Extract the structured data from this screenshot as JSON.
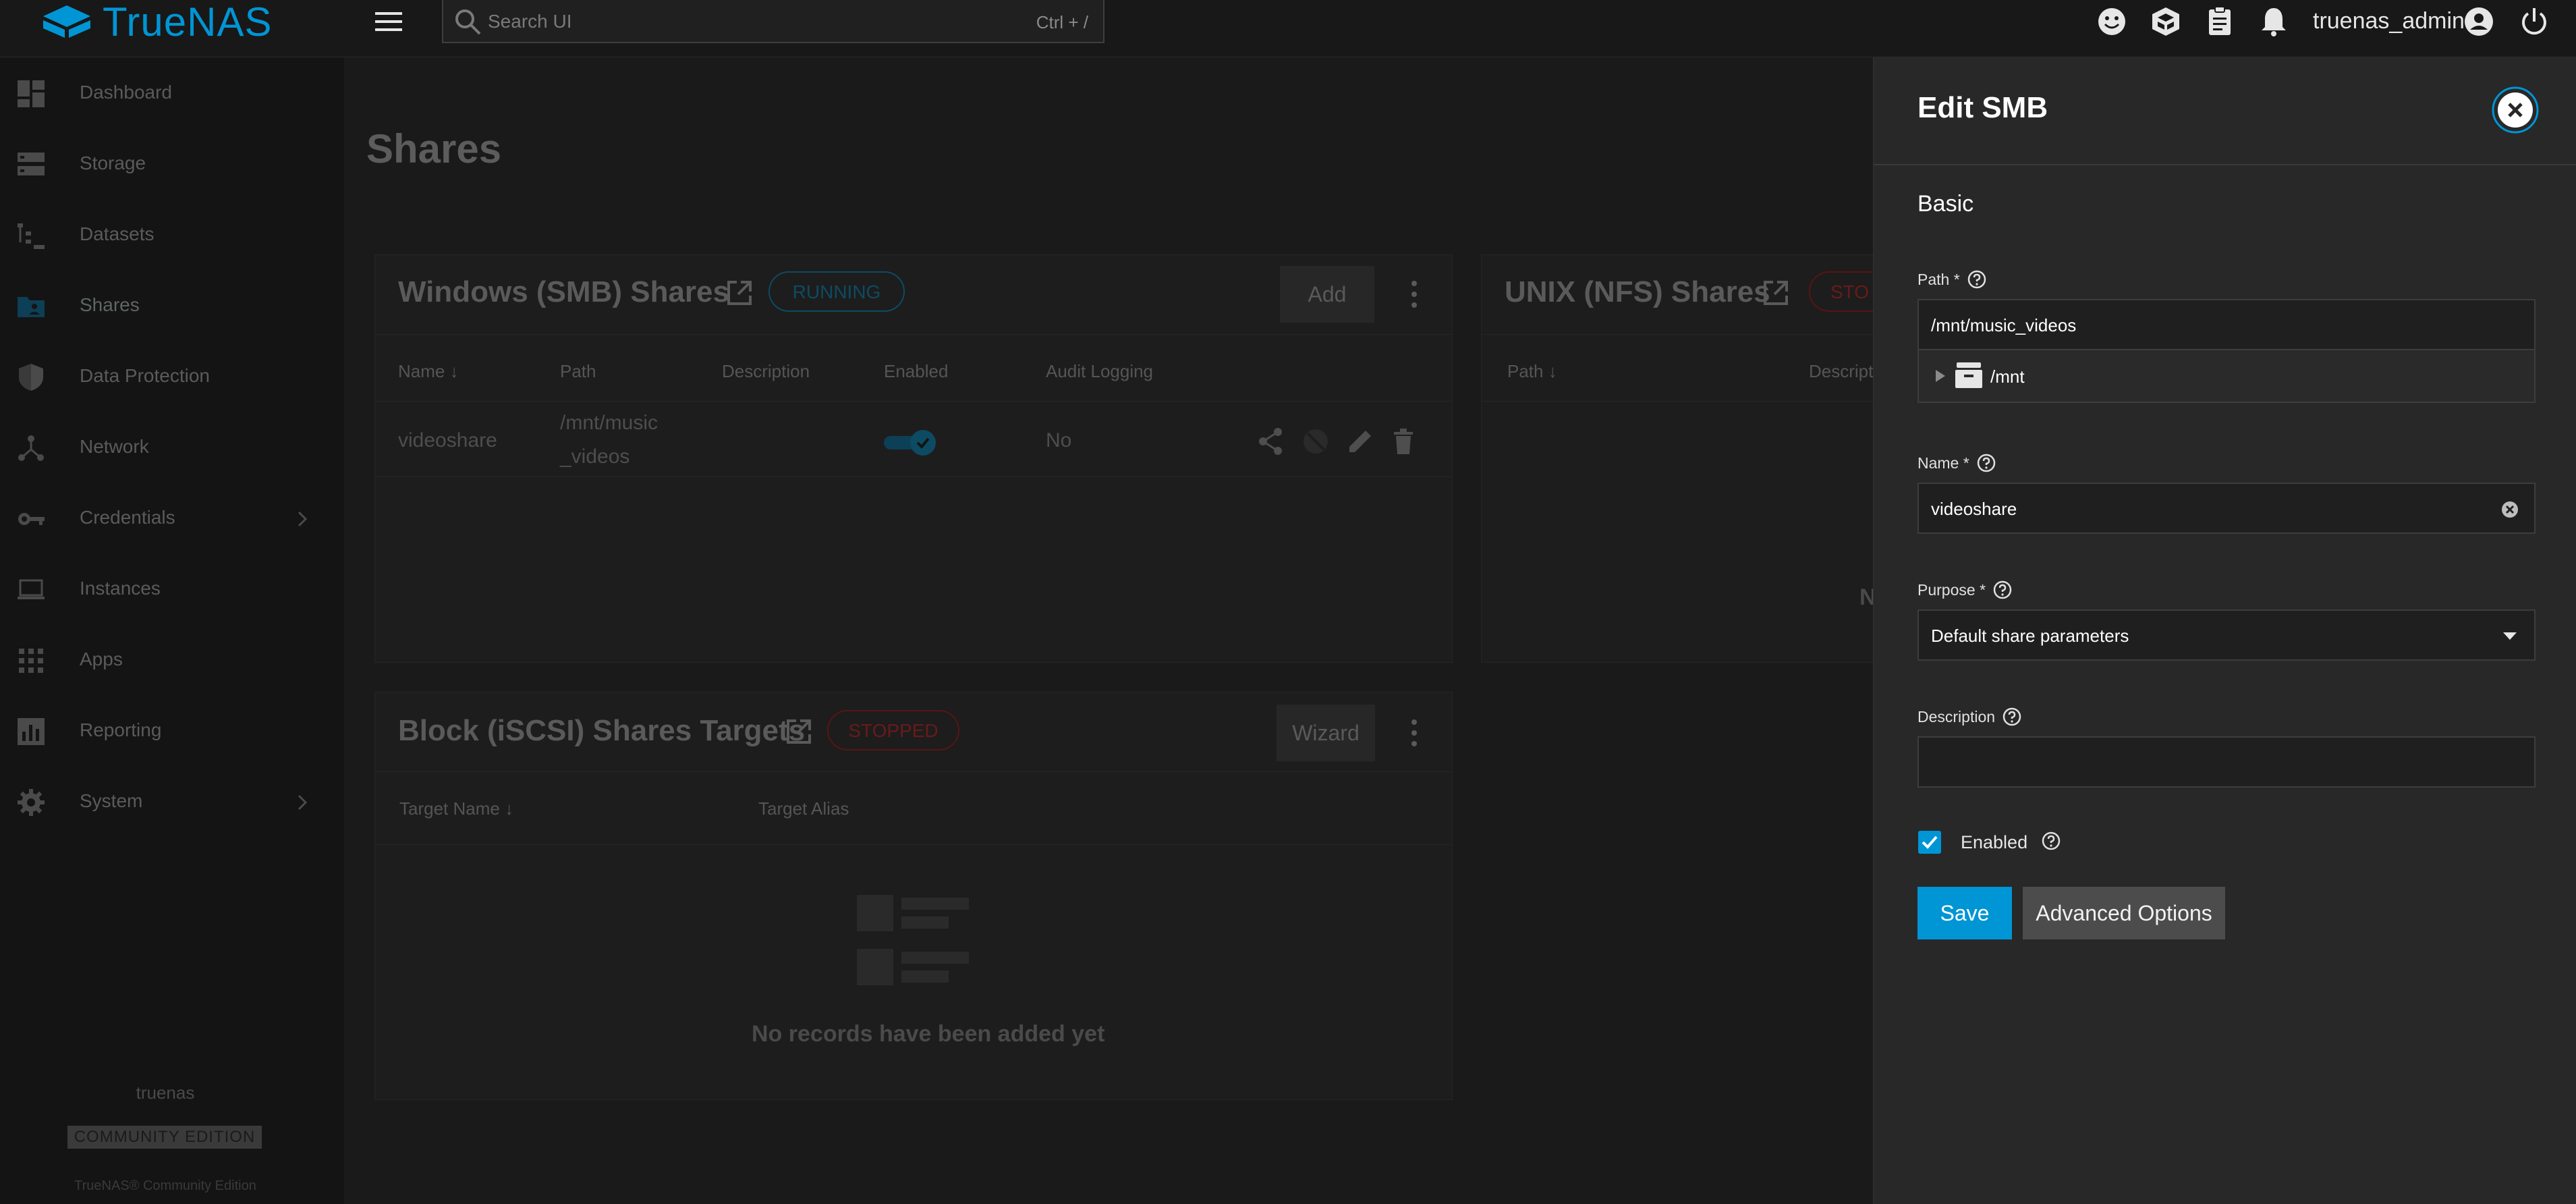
{
  "app": {
    "logo_text": "TrueNAS"
  },
  "search": {
    "placeholder": "Search UI",
    "shortcut": "Ctrl + /"
  },
  "user": {
    "name": "truenas_admin"
  },
  "sidebar": {
    "items": [
      {
        "label": "Dashboard",
        "icon": "dashboard-icon"
      },
      {
        "label": "Storage",
        "icon": "storage-icon"
      },
      {
        "label": "Datasets",
        "icon": "datasets-icon"
      },
      {
        "label": "Shares",
        "icon": "folder-shared-icon",
        "active": true
      },
      {
        "label": "Data Protection",
        "icon": "shield-icon"
      },
      {
        "label": "Network",
        "icon": "network-icon"
      },
      {
        "label": "Credentials",
        "icon": "key-icon",
        "has_children": true
      },
      {
        "label": "Instances",
        "icon": "laptop-icon"
      },
      {
        "label": "Apps",
        "icon": "apps-grid-icon"
      },
      {
        "label": "Reporting",
        "icon": "chart-icon"
      },
      {
        "label": "System",
        "icon": "gear-icon",
        "has_children": true
      }
    ],
    "hostname": "truenas",
    "edition_badge": "COMMUNITY EDITION",
    "copyright": "TrueNAS® Community Edition"
  },
  "page": {
    "title": "Shares"
  },
  "smb_card": {
    "title": "Windows (SMB) Shares",
    "status": "RUNNING",
    "add_label": "Add",
    "columns": [
      "Name",
      "Path",
      "Description",
      "Enabled",
      "Audit Logging"
    ],
    "row": {
      "name": "videoshare",
      "path_line1": "/mnt/music",
      "path_line2": "_videos",
      "description": "",
      "audit": "No"
    }
  },
  "nfs_card": {
    "title": "UNIX (NFS) Shares",
    "status": "STO",
    "columns": [
      "Path",
      "Descript"
    ],
    "empty_partial": "N"
  },
  "iscsi_card": {
    "title": "Block (iSCSI) Shares Targets",
    "status": "STOPPED",
    "wizard_label": "Wizard",
    "columns": [
      "Target Name",
      "Target Alias"
    ],
    "empty_text": "No records have been added yet"
  },
  "edit_panel": {
    "title": "Edit SMB",
    "section": "Basic",
    "path": {
      "label": "Path",
      "required": "*",
      "value": "/mnt/music_videos",
      "tree_root": "/mnt"
    },
    "name": {
      "label": "Name",
      "required": "*",
      "value": "videoshare"
    },
    "purpose": {
      "label": "Purpose",
      "required": "*",
      "value": "Default share parameters"
    },
    "description": {
      "label": "Description",
      "value": ""
    },
    "enabled": {
      "label": "Enabled",
      "checked": true
    },
    "save_label": "Save",
    "advanced_label": "Advanced Options"
  },
  "colors": {
    "accent": "#0095d5",
    "panel_bg": "#282828",
    "page_bg": "#1a1a1a"
  }
}
